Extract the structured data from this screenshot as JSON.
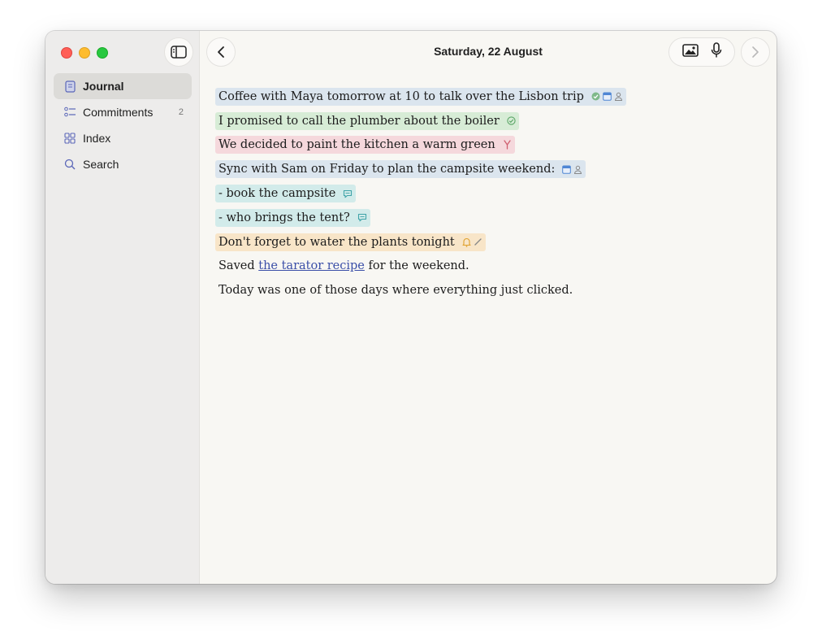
{
  "header": {
    "date": "Saturday, 22 August"
  },
  "sidebar": {
    "items": [
      {
        "label": "Journal",
        "icon": "journal-icon",
        "active": true,
        "count": ""
      },
      {
        "label": "Commitments",
        "icon": "commitments-icon",
        "active": false,
        "count": "2"
      },
      {
        "label": "Index",
        "icon": "grid-icon",
        "active": false,
        "count": ""
      },
      {
        "label": "Search",
        "icon": "search-icon",
        "active": false,
        "count": ""
      }
    ]
  },
  "entries": [
    {
      "text": "Coffee with Maya tomorrow at 10 to talk over the Lisbon trip",
      "color": "#dbe5ee",
      "icons": [
        "check-circle-icon",
        "calendar-icon",
        "person-icon"
      ]
    },
    {
      "text": "I promised to call the plumber about the boiler",
      "color": "#d7ecd6",
      "icons": [
        "check-circle-outline-icon"
      ]
    },
    {
      "text": "We decided to paint the kitchen a warm green",
      "color": "#f5d8dc",
      "icons": [
        "decision-fork-icon"
      ]
    },
    {
      "text": "Sync with Sam on Friday to plan the campsite weekend:",
      "color": "#dbe5ee",
      "icons": [
        "calendar-icon",
        "person-icon"
      ]
    },
    {
      "text": "- book the campsite",
      "color": "#d2ebea",
      "icons": [
        "comment-icon"
      ]
    },
    {
      "text": "- who brings the tent?",
      "color": "#d2ebea",
      "icons": [
        "comment-icon"
      ]
    },
    {
      "text": "Don't forget to water the plants tonight",
      "color": "#f8e5c8",
      "icons": [
        "bell-icon",
        "pencil-icon"
      ]
    }
  ],
  "saved": {
    "prefix": "Saved ",
    "link": "the tarator recipe",
    "suffix": " for the weekend."
  },
  "closing": "Today was one of those days where everything just clicked.",
  "colors": {
    "sidebar_bg": "#edeceb",
    "content_bg": "#f8f7f3",
    "link": "#3b4fa8"
  }
}
